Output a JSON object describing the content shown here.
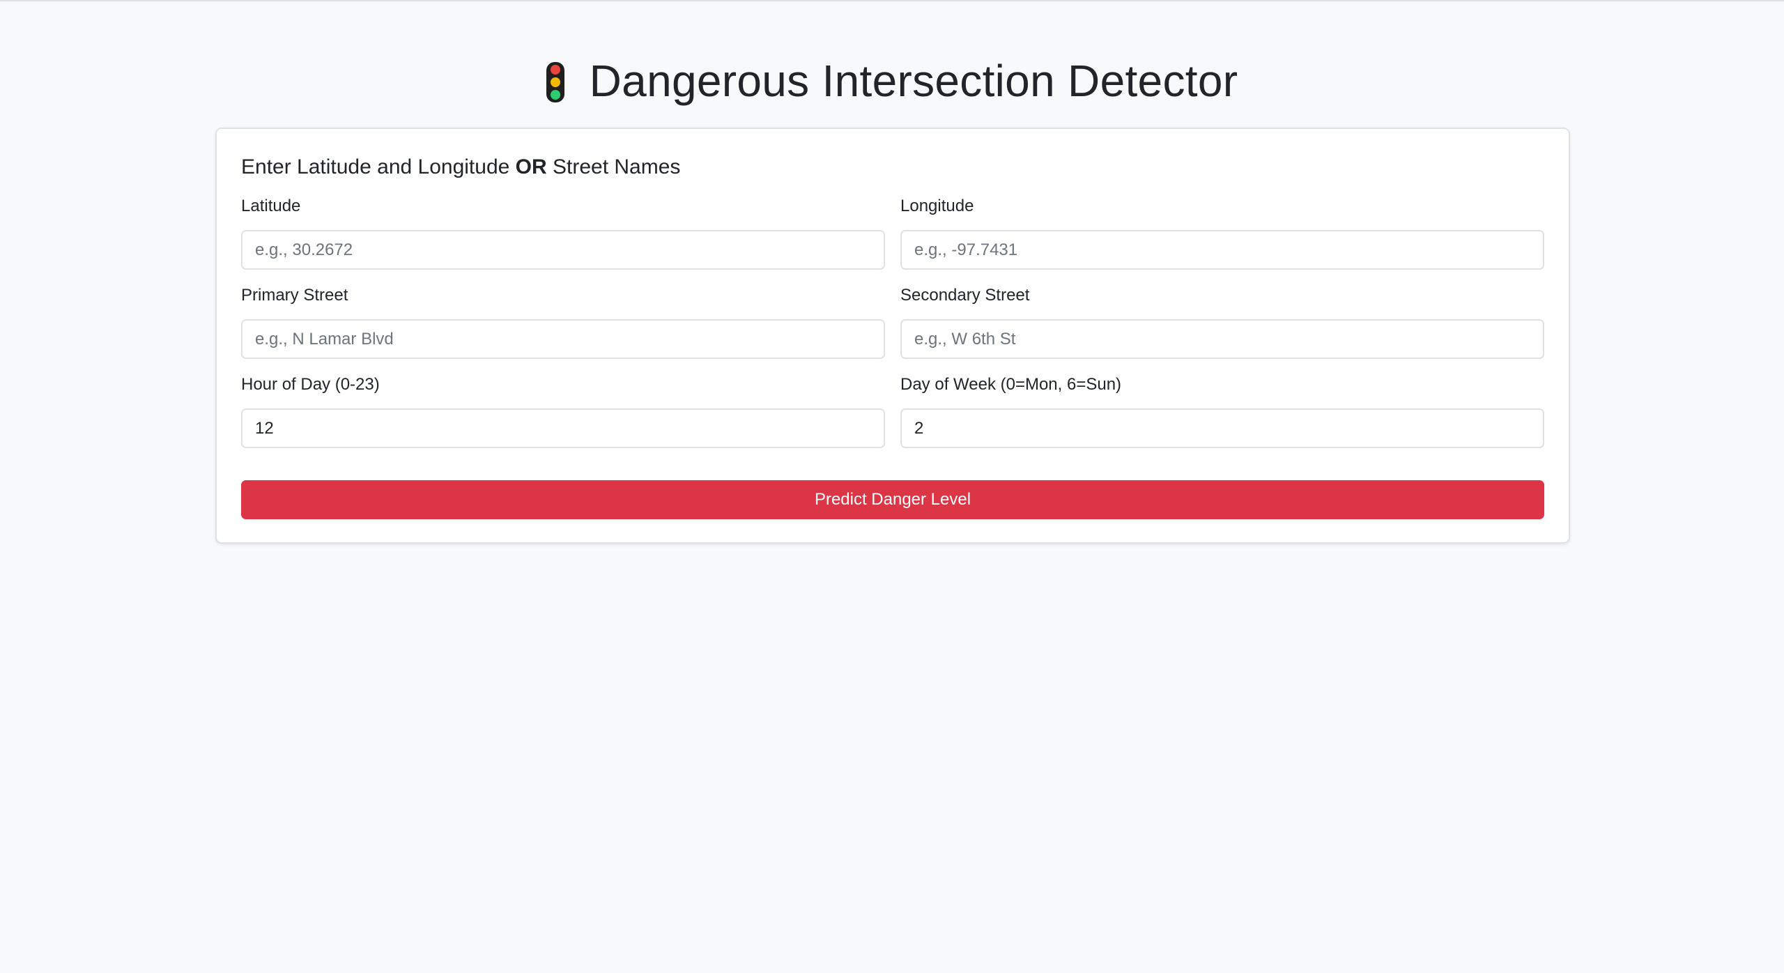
{
  "header": {
    "icon": "traffic-light-icon",
    "title": "Dangerous Intersection Detector"
  },
  "form": {
    "heading_prefix": "Enter Latitude and Longitude ",
    "heading_emphasis": "OR",
    "heading_suffix": " Street Names",
    "fields": {
      "latitude": {
        "label": "Latitude",
        "placeholder": "e.g., 30.2672",
        "value": ""
      },
      "longitude": {
        "label": "Longitude",
        "placeholder": "e.g., -97.7431",
        "value": ""
      },
      "primary_street": {
        "label": "Primary Street",
        "placeholder": "e.g., N Lamar Blvd",
        "value": ""
      },
      "secondary_street": {
        "label": "Secondary Street",
        "placeholder": "e.g., W 6th St",
        "value": ""
      },
      "hour": {
        "label": "Hour of Day (0-23)",
        "placeholder": "",
        "value": "12"
      },
      "day": {
        "label": "Day of Week (0=Mon, 6=Sun)",
        "placeholder": "",
        "value": "2"
      }
    },
    "submit_label": "Predict Danger Level"
  },
  "colors": {
    "accent_danger": "#dc3545",
    "page_background": "#f8f9fa",
    "light_red": "#e8453c",
    "light_yellow": "#f5b800",
    "light_green": "#2ecc71"
  }
}
